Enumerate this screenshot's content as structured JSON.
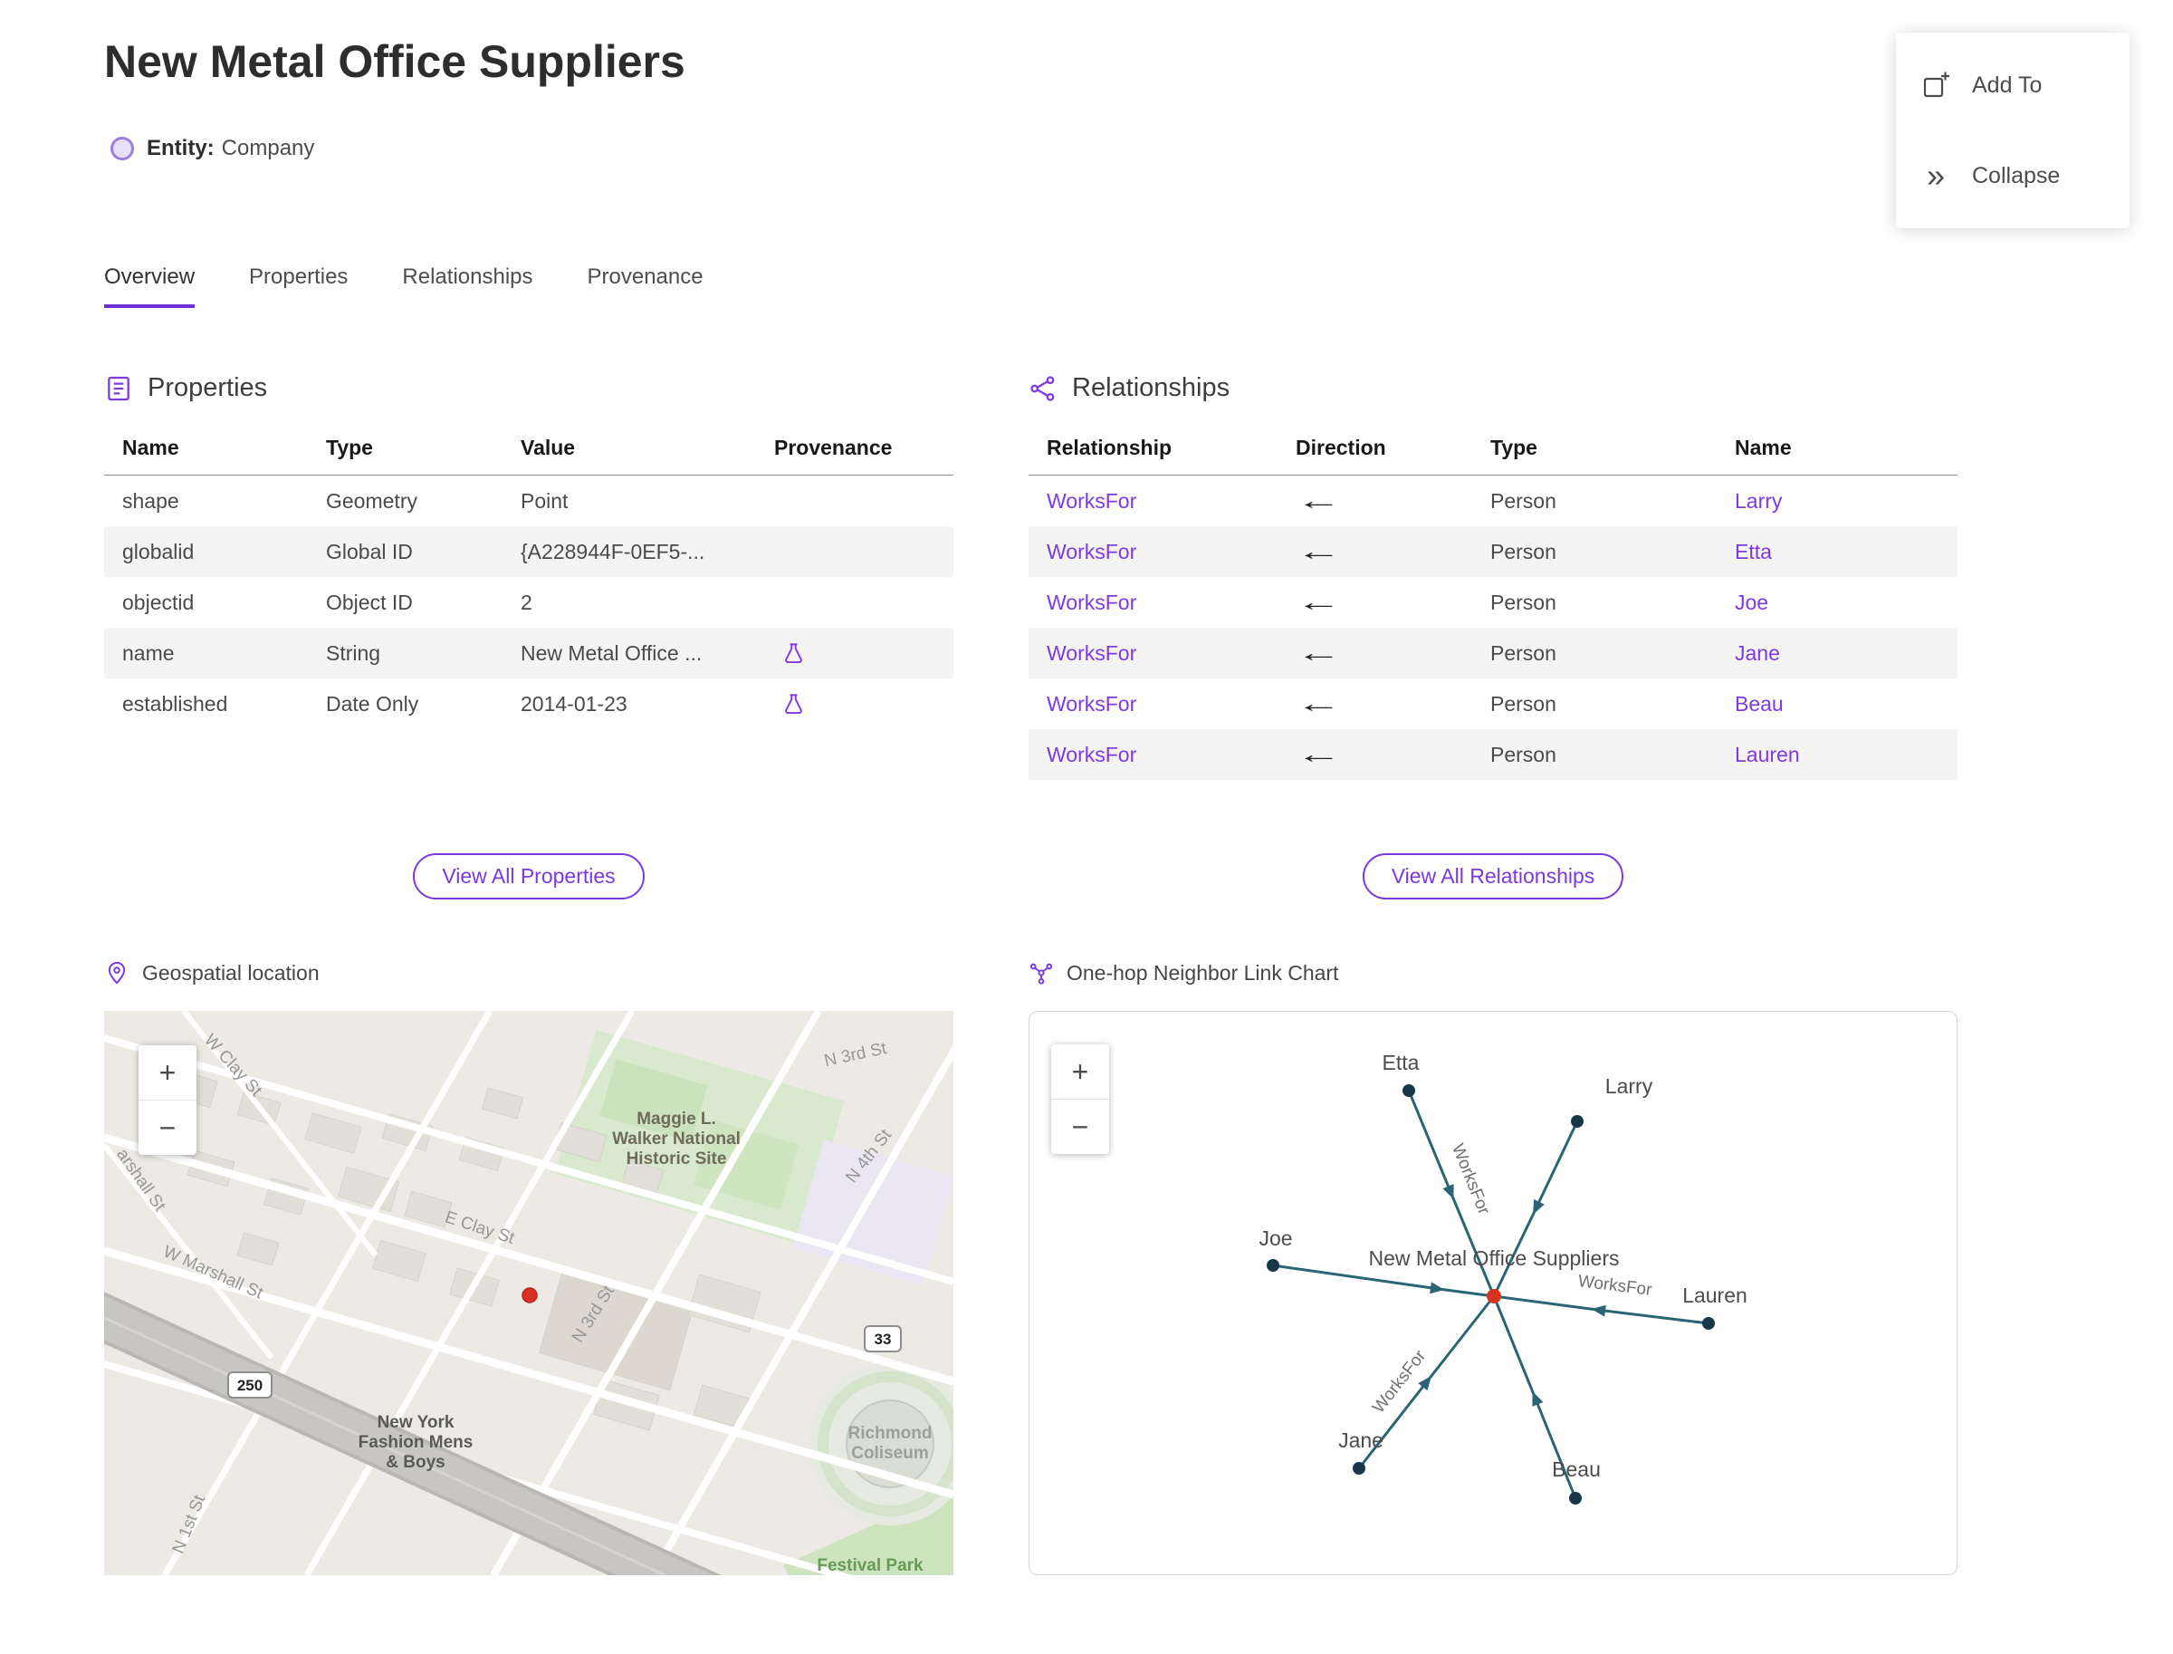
{
  "colors": {
    "accent": "#7c39dd",
    "link": "#8038e0",
    "tab_underline": "#6e2fd8",
    "row_stripe": "#f4f4f4",
    "graph_edge": "#2a6475",
    "graph_node": "#18384a",
    "graph_center_node": "#d6341f",
    "map_marker": "#d93025"
  },
  "header": {
    "title": "New Metal Office Suppliers",
    "entity_label": "Entity:",
    "entity_type": "Company"
  },
  "actions": {
    "add_to": "Add To",
    "collapse": "Collapse",
    "collapse_icon": "»"
  },
  "tabs": [
    "Overview",
    "Properties",
    "Relationships",
    "Provenance"
  ],
  "zoom": {
    "in": "+",
    "out": "−"
  },
  "properties": {
    "title": "Properties",
    "columns": [
      "Name",
      "Type",
      "Value",
      "Provenance"
    ],
    "rows": [
      {
        "name": "shape",
        "type": "Geometry",
        "value": "Point"
      },
      {
        "name": "globalid",
        "type": "Global ID",
        "value": "{A228944F-0EF5-..."
      },
      {
        "name": "objectid",
        "type": "Object ID",
        "value": "2"
      },
      {
        "name": "name",
        "type": "String",
        "value": "New Metal Office ...",
        "provenance_icon": true
      },
      {
        "name": "established",
        "type": "Date Only",
        "value": "2014-01-23",
        "provenance_icon": true
      }
    ],
    "view_all": "View All Properties"
  },
  "relationships": {
    "title": "Relationships",
    "columns": [
      "Relationship",
      "Direction",
      "Type",
      "Name"
    ],
    "rows": [
      {
        "relationship": "WorksFor",
        "direction": "←",
        "type": "Person",
        "name": "Larry"
      },
      {
        "relationship": "WorksFor",
        "direction": "←",
        "type": "Person",
        "name": "Etta"
      },
      {
        "relationship": "WorksFor",
        "direction": "←",
        "type": "Person",
        "name": "Joe"
      },
      {
        "relationship": "WorksFor",
        "direction": "←",
        "type": "Person",
        "name": "Jane"
      },
      {
        "relationship": "WorksFor",
        "direction": "←",
        "type": "Person",
        "name": "Beau"
      },
      {
        "relationship": "WorksFor",
        "direction": "←",
        "type": "Person",
        "name": "Lauren"
      }
    ],
    "view_all": "View All Relationships"
  },
  "map": {
    "title": "Geospatial location",
    "shield_33": "33",
    "shield_250": "250",
    "labels": {
      "n3rd_top": "N 3rd St",
      "n4th": "N 4th St",
      "n3rd_mid": "N 3rd St",
      "n1st": "N 1st St",
      "w_clay": "W Clay St",
      "marshall_partial": "arshall St",
      "w_marshall": "W Marshall St",
      "e_clay": "E Clay St",
      "maggie_1": "Maggie L.",
      "maggie_2": "Walker National",
      "maggie_3": "Historic Site",
      "nyf_1": "New York",
      "nyf_2": "Fashion Mens",
      "nyf_3": "& Boys",
      "coliseum_1": "Richmond",
      "coliseum_2": "Coliseum",
      "festival": "Festival Park"
    }
  },
  "graph": {
    "title": "One-hop Neighbor Link Chart",
    "center_label": "New Metal Office Suppliers",
    "edge_label": "WorksFor",
    "nodes": [
      "Etta",
      "Larry",
      "Joe",
      "Lauren",
      "Jane",
      "Beau"
    ]
  }
}
